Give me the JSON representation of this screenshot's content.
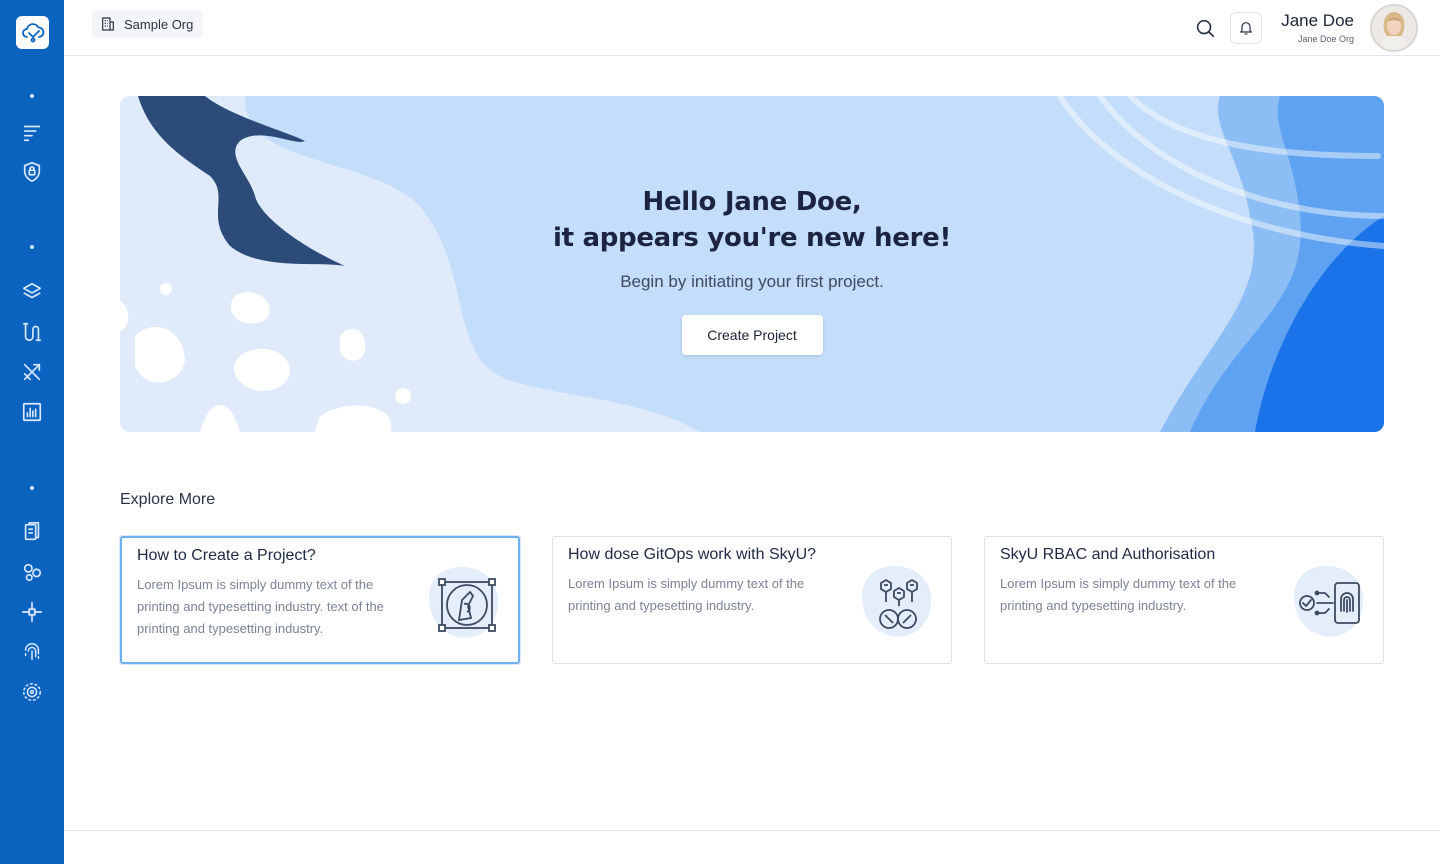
{
  "header": {
    "org_name": "Sample Org",
    "user_name": "Jane Doe",
    "user_org": "Jane Doe Org"
  },
  "sidebar": {
    "icons": [
      "cloud-logo-icon",
      "menu-lines-icon",
      "shield-lock-icon",
      "layers-icon",
      "pipeline-icon",
      "tools-icon",
      "bar-chart-icon",
      "documents-icon",
      "circles-icon",
      "connectors-icon",
      "fingerprint-icon",
      "target-settings-icon"
    ]
  },
  "hero": {
    "title_line1": "Hello Jane Doe,",
    "title_line2": "it appears you're new here!",
    "subtitle": "Begin by initiating your first project.",
    "button_label": "Create Project"
  },
  "explore": {
    "title": "Explore More",
    "cards": [
      {
        "title": "How to Create a  Project?",
        "description": "Lorem Ipsum is simply dummy text of the printing and typesetting industry. text of the printing and typesetting industry.",
        "icon": "design-pen-icon"
      },
      {
        "title": "How dose GitOps work with SkyU?",
        "description": "Lorem Ipsum is simply dummy text of the printing and typesetting industry.",
        "icon": "gitops-icon"
      },
      {
        "title": "SkyU RBAC and Authorisation",
        "description": "Lorem Ipsum is simply dummy text of the printing and typesetting industry.",
        "icon": "fingerprint-auth-icon"
      }
    ]
  },
  "colors": {
    "sidebar": "#0b63c0",
    "hero_bg": "#dfeafb",
    "accent": "#1a73e8",
    "active_border": "#6fb0f0"
  }
}
